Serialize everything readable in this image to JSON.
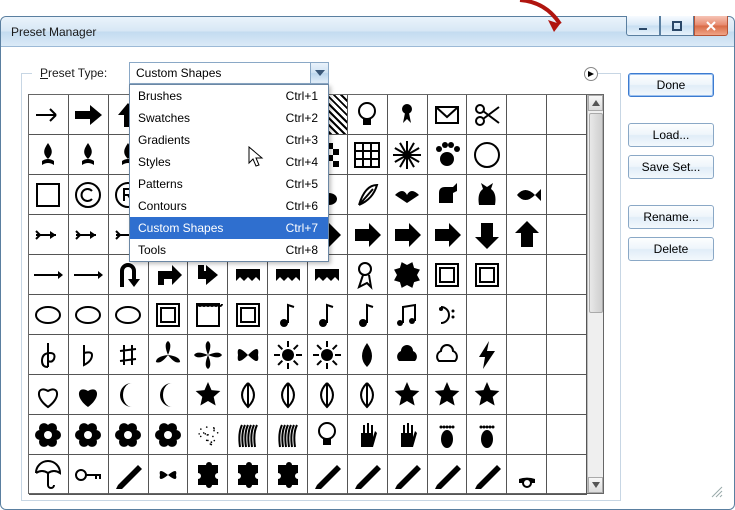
{
  "annotation": {
    "label": "menu"
  },
  "window": {
    "title": "Preset Manager"
  },
  "presetTypeLabel": {
    "first": "P",
    "rest": "reset Type:"
  },
  "combo": {
    "value": "Custom Shapes"
  },
  "dropdown": {
    "items": [
      {
        "label": "Brushes",
        "shortcut": "Ctrl+1",
        "selected": false
      },
      {
        "label": "Swatches",
        "shortcut": "Ctrl+2",
        "selected": false
      },
      {
        "label": "Gradients",
        "shortcut": "Ctrl+3",
        "selected": false
      },
      {
        "label": "Styles",
        "shortcut": "Ctrl+4",
        "selected": false
      },
      {
        "label": "Patterns",
        "shortcut": "Ctrl+5",
        "selected": false
      },
      {
        "label": "Contours",
        "shortcut": "Ctrl+6",
        "selected": false
      },
      {
        "label": "Custom Shapes",
        "shortcut": "Ctrl+7",
        "selected": true
      },
      {
        "label": "Tools",
        "shortcut": "Ctrl+8",
        "selected": false
      }
    ]
  },
  "buttons": {
    "done": "Done",
    "load": "Load...",
    "saveSet": "Save Set...",
    "rename": "Rename...",
    "delete": "Delete"
  },
  "shapeGrid": {
    "columns": 14,
    "rows": 10,
    "shapes": [
      "arrow-thin-right",
      "arrow-bold-right",
      "arrow-up",
      "arrow-down",
      "arrow-left",
      "arrow-right-alt",
      "arrow-left-alt",
      "hatch",
      "lightbulb",
      "pushpin",
      "envelope",
      "scissors",
      "null",
      "null",
      "fleur-de-lis",
      "fleur-de-lis",
      "fleur-de-lis",
      "fleur-de-lis",
      "club",
      "club",
      "hatch",
      "checkerboard",
      "grid",
      "starburst",
      "paw",
      "circle-outline",
      "null",
      "null",
      "square-outline",
      "copyright",
      "registered",
      "trademark",
      "target",
      "no-sign",
      "snail",
      "rabbit",
      "feather",
      "bird",
      "dog",
      "cat",
      "fish",
      "null",
      "arrow-feather",
      "arrow-feather",
      "arrow-feather",
      "arrow-feather",
      "arrow-thick",
      "arrow-thick",
      "arrow-thick",
      "arrow-block",
      "arrow-block",
      "arrow-block",
      "arrow-block-right",
      "arrow-block-down",
      "arrow-block-up",
      "null",
      "arrow-long",
      "arrow-long",
      "u-turn",
      "turn-arrow",
      "corner-arrow",
      "banner",
      "banner",
      "banner",
      "ribbon",
      "seal",
      "frame",
      "frame",
      "null",
      "null",
      "oval-outline",
      "oval-outline",
      "oval-outline",
      "frame-square",
      "frame-stamp",
      "frame-rounded",
      "music-note",
      "music-note",
      "music-note",
      "music-notes",
      "bass-clef",
      "null",
      "null",
      "null",
      "treble-clef",
      "flat",
      "sharp",
      "leaf-3",
      "leaf-4",
      "butterfly",
      "sun",
      "sun",
      "drop",
      "cloud",
      "cloud-outline",
      "lightning",
      "null",
      "null",
      "heart-outline",
      "heart",
      "crescent",
      "crescent",
      "star",
      "leaf",
      "leaf",
      "leaf",
      "leaf",
      "star",
      "star",
      "star",
      "null",
      "null",
      "flower",
      "flower",
      "flower",
      "flower",
      "dots",
      "grass",
      "grass",
      "lightbulb",
      "hand",
      "hand",
      "foot",
      "foot",
      "null",
      "null",
      "umbrella",
      "key",
      "pencil",
      "bow",
      "puzzle",
      "puzzle",
      "puzzle",
      "pencil",
      "pencil",
      "pencil",
      "pencil",
      "pencil",
      "phone",
      "null"
    ]
  }
}
